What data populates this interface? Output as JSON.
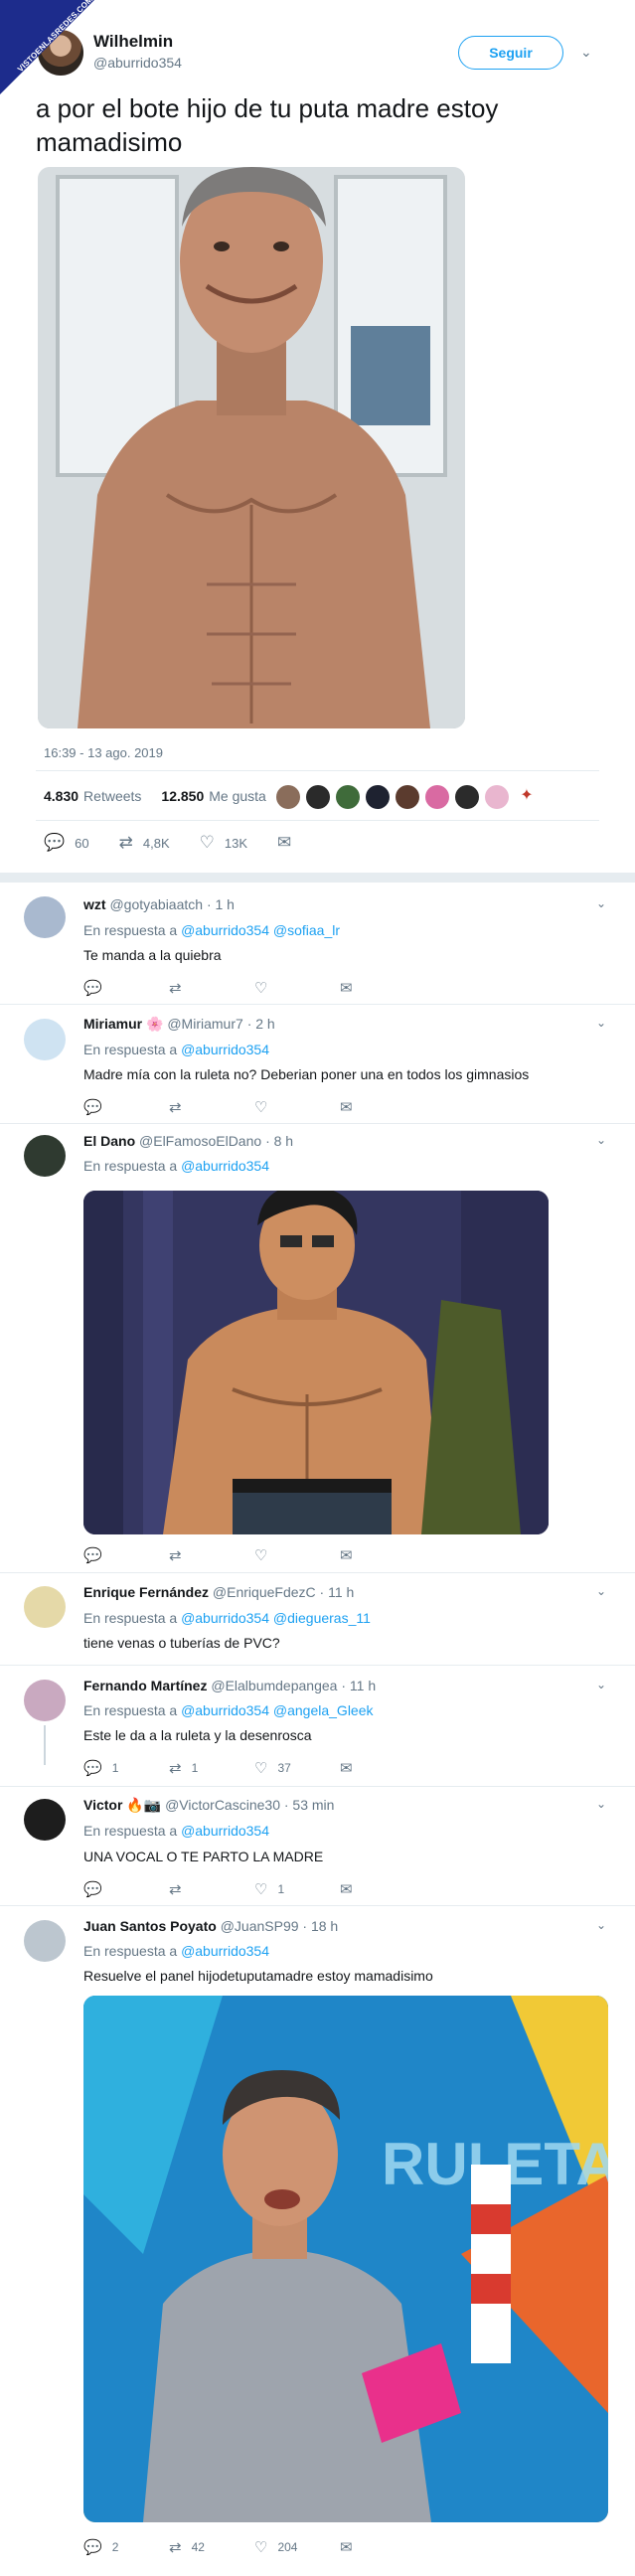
{
  "watermark": {
    "text": "VISTOENLASREDES.COM"
  },
  "tweet": {
    "author_name": "Wilhelmin",
    "author_handle": "@aburrido354",
    "follow_label": "Seguir",
    "text": "a por el bote hijo de tu puta madre estoy mamadisimo",
    "timestamp": "16:39 - 13 ago. 2019",
    "retweets_count": "4.830",
    "retweets_label": "Retweets",
    "likes_count": "12.850",
    "likes_label": "Me gusta",
    "actions": {
      "replies": "60",
      "retweets": "4,8K",
      "likes": "13K"
    }
  },
  "replies": [
    {
      "name": "wzt",
      "handle": "@gotyabiaatch",
      "time": "· 1 h",
      "reply_prefix": "En respuesta a",
      "reply_to": "@aburrido354 @sofiaa_lr",
      "text": "Te manda a la quiebra",
      "counts": {
        "replies": "",
        "retweets": "",
        "likes": ""
      }
    },
    {
      "name": "Miriamur 🌸",
      "handle": "@Miriamur7",
      "time": "· 2 h",
      "reply_prefix": "En respuesta a",
      "reply_to": "@aburrido354",
      "text": "Madre mía con la ruleta no? Deberian poner una en todos los gimnasios",
      "counts": {
        "replies": "",
        "retweets": "",
        "likes": ""
      }
    },
    {
      "name": "El Dano",
      "handle": "@ElFamosoElDano",
      "time": "· 8 h",
      "reply_prefix": "En respuesta a",
      "reply_to": "@aburrido354",
      "text": "",
      "counts": {
        "replies": "",
        "retweets": "",
        "likes": ""
      }
    },
    {
      "name": "Enrique Fernández",
      "handle": "@EnriqueFdezC",
      "time": "· 11 h",
      "reply_prefix": "En respuesta a",
      "reply_to": "@aburrido354 @diegueras_11",
      "text": "tiene venas o tuberías de PVC?",
      "counts": {
        "replies": "",
        "retweets": "",
        "likes": ""
      }
    },
    {
      "name": "Fernando Martínez",
      "handle": "@Elalbumdepangea",
      "time": "· 11 h",
      "reply_prefix": "En respuesta a",
      "reply_to": "@aburrido354 @angela_Gleek",
      "text": "Este le da a la ruleta y la desenrosca",
      "counts": {
        "replies": "1",
        "retweets": "1",
        "likes": "37"
      }
    },
    {
      "name": "Victor 🔥📷",
      "handle": "@VictorCascine30",
      "time": "· 53 min",
      "reply_prefix": "En respuesta a",
      "reply_to": "@aburrido354",
      "text": "UNA VOCAL O TE PARTO LA MADRE",
      "counts": {
        "replies": "",
        "retweets": "",
        "likes": "1"
      }
    },
    {
      "name": "Juan Santos Poyato",
      "handle": "@JuanSP99",
      "time": "· 18 h",
      "reply_prefix": "En respuesta a",
      "reply_to": "@aburrido354",
      "text": "Resuelve el panel hijodetuputamadre estoy mamadisimo",
      "counts": {
        "replies": "2",
        "retweets": "42",
        "likes": "204"
      }
    }
  ],
  "show_sign": "RULETA DE LA SUERTE"
}
